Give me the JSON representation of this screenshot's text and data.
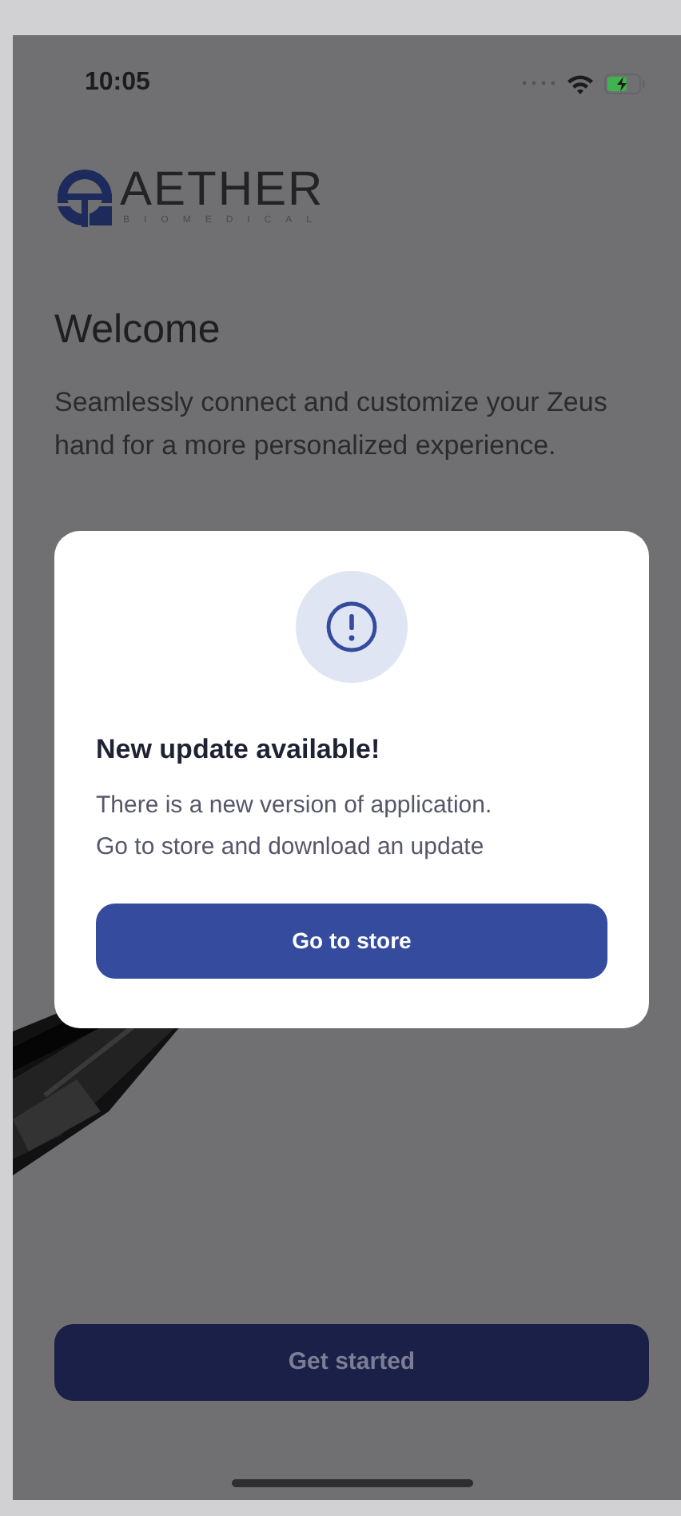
{
  "status_bar": {
    "time": "10:05"
  },
  "logo": {
    "name": "AETHER",
    "tagline": "BIOMEDICAL"
  },
  "welcome": {
    "title": "Welcome",
    "text": "Seamlessly connect and customize your Zeus hand for a more personalized experience."
  },
  "primary_button": {
    "label": "Get started"
  },
  "dialog": {
    "title": "New update available!",
    "message_lines": [
      "There is a new version of application.",
      "Go to store and download an update"
    ],
    "button": "Go to store"
  }
}
